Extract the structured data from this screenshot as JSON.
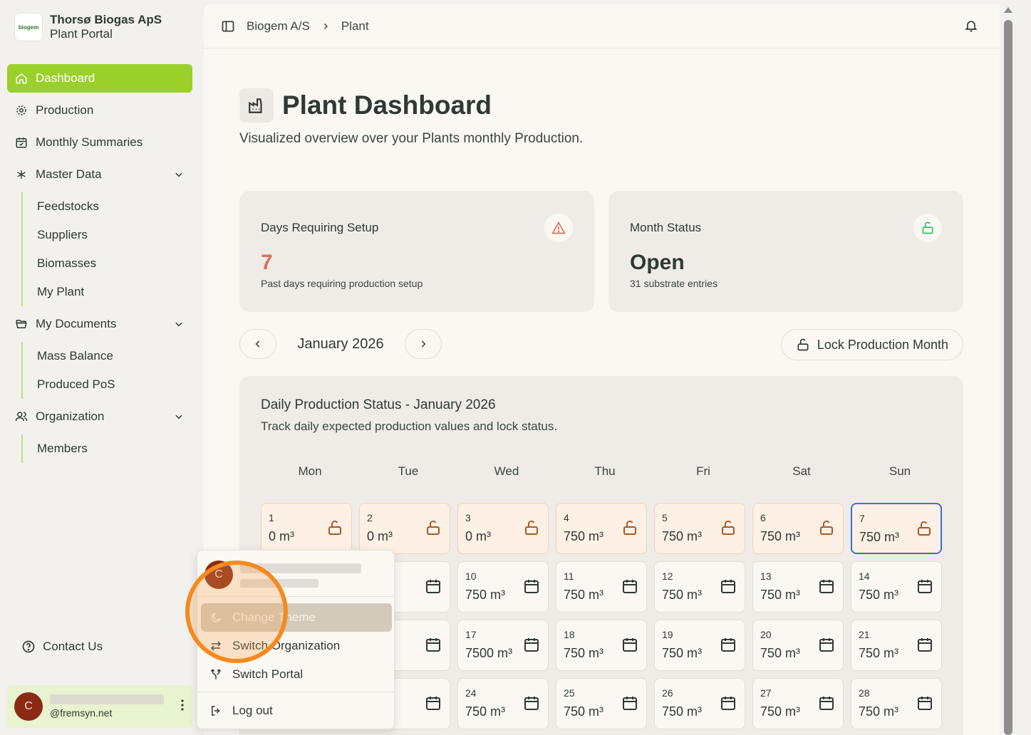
{
  "brand": {
    "logo_text": "biogem",
    "name": "Thorsø Biogas ApS",
    "sub": "Plant Portal"
  },
  "nav": {
    "dashboard": "Dashboard",
    "production": "Production",
    "monthly_summaries": "Monthly Summaries",
    "master_data": "Master Data",
    "master_items": [
      "Feedstocks",
      "Suppliers",
      "Biomasses",
      "My Plant"
    ],
    "my_documents": "My Documents",
    "document_items": [
      "Mass Balance",
      "Produced PoS"
    ],
    "organization": "Organization",
    "organization_items": [
      "Members"
    ],
    "contact": "Contact Us"
  },
  "user": {
    "initial": "C",
    "email": "@fremsyn.net"
  },
  "breadcrumb": [
    "Biogem A/S",
    "Plant"
  ],
  "page": {
    "title": "Plant Dashboard",
    "subtitle": "Visualized overview over your Plants monthly Production."
  },
  "cards": {
    "setup": {
      "title": "Days Requiring Setup",
      "value": "7",
      "note": "Past days requiring production setup",
      "color": "#d9725d"
    },
    "status": {
      "title": "Month Status",
      "value": "Open",
      "note": "31 substrate entries",
      "color": "#2e3a33"
    }
  },
  "month": {
    "label": "January 2026",
    "lock_button": "Lock Production Month"
  },
  "calendar": {
    "title": "Daily Production Status - January 2026",
    "subtitle": "Track daily expected production values and lock status.",
    "days_of_week": [
      "Mon",
      "Tue",
      "Wed",
      "Thu",
      "Fri",
      "Sat",
      "Sun"
    ],
    "unit": "m³",
    "days": [
      {
        "num": "1",
        "val": "0 m³",
        "state": "setup"
      },
      {
        "num": "2",
        "val": "0 m³",
        "state": "setup"
      },
      {
        "num": "3",
        "val": "0 m³",
        "state": "setup"
      },
      {
        "num": "4",
        "val": "750 m³",
        "state": "setup"
      },
      {
        "num": "5",
        "val": "750 m³",
        "state": "setup"
      },
      {
        "num": "6",
        "val": "750 m³",
        "state": "setup"
      },
      {
        "num": "7",
        "val": "750 m³",
        "state": "today"
      },
      {
        "num": "",
        "val": "m³",
        "state": "future"
      },
      {
        "num": "",
        "val": "m³",
        "state": "future"
      },
      {
        "num": "10",
        "val": "750 m³",
        "state": "future"
      },
      {
        "num": "11",
        "val": "750 m³",
        "state": "future"
      },
      {
        "num": "12",
        "val": "750 m³",
        "state": "future"
      },
      {
        "num": "13",
        "val": "750 m³",
        "state": "future"
      },
      {
        "num": "14",
        "val": "750 m³",
        "state": "future"
      },
      {
        "num": "",
        "val": "m³",
        "state": "future"
      },
      {
        "num": "",
        "val": "m³",
        "state": "future"
      },
      {
        "num": "17",
        "val": "7500 m³",
        "state": "future"
      },
      {
        "num": "18",
        "val": "750 m³",
        "state": "future"
      },
      {
        "num": "19",
        "val": "750 m³",
        "state": "future"
      },
      {
        "num": "20",
        "val": "750 m³",
        "state": "future"
      },
      {
        "num": "21",
        "val": "750 m³",
        "state": "future"
      },
      {
        "num": "",
        "val": "m³",
        "state": "future"
      },
      {
        "num": "",
        "val": "m³",
        "state": "future"
      },
      {
        "num": "24",
        "val": "750 m³",
        "state": "future"
      },
      {
        "num": "25",
        "val": "750 m³",
        "state": "future"
      },
      {
        "num": "26",
        "val": "750 m³",
        "state": "future"
      },
      {
        "num": "27",
        "val": "750 m³",
        "state": "future"
      },
      {
        "num": "28",
        "val": "750 m³",
        "state": "future"
      }
    ]
  },
  "user_menu": {
    "initial": "C",
    "items": {
      "change_theme": "Change Theme",
      "switch_org": "Switch Organization",
      "switch_portal": "Switch Portal",
      "logout": "Log out"
    }
  },
  "colors": {
    "accent": "#9ad02a",
    "today_border": "#3d6fd6",
    "lock_icon": "#a55b22",
    "open_icon": "#2bbf5e",
    "alert_icon": "#d9725d",
    "highlight_ring": "#f58a1f"
  }
}
